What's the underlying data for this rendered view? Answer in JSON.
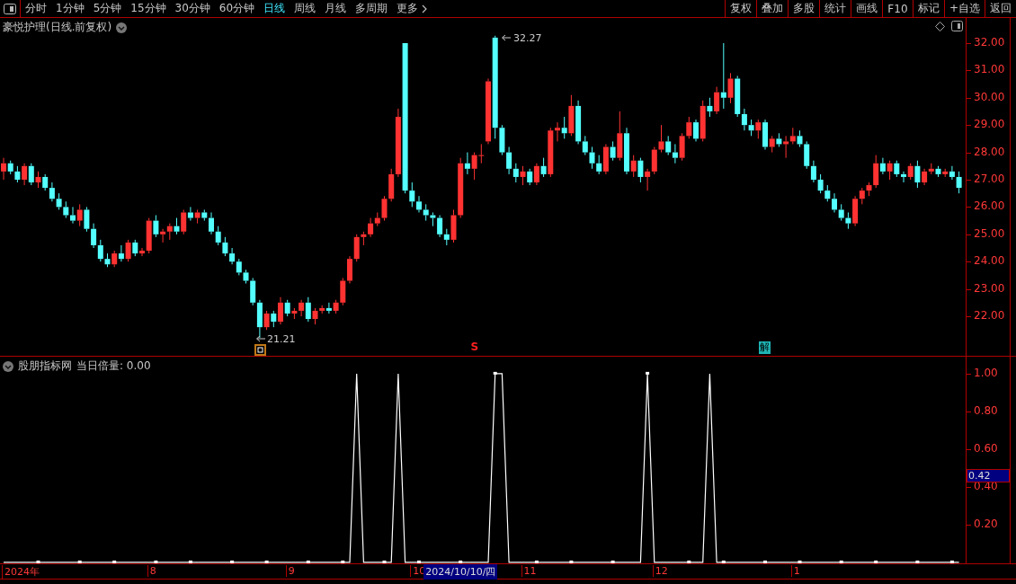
{
  "toolbar": {
    "periods": [
      {
        "label": "分时",
        "selected": false
      },
      {
        "label": "1分钟",
        "selected": false
      },
      {
        "label": "5分钟",
        "selected": false
      },
      {
        "label": "15分钟",
        "selected": false
      },
      {
        "label": "30分钟",
        "selected": false
      },
      {
        "label": "60分钟",
        "selected": false
      },
      {
        "label": "日线",
        "selected": true
      },
      {
        "label": "周线",
        "selected": false
      },
      {
        "label": "月线",
        "selected": false
      },
      {
        "label": "多周期",
        "selected": false
      }
    ],
    "more": "更多",
    "actions": [
      "复权",
      "叠加",
      "多股",
      "统计",
      "画线",
      "F10",
      "标记",
      "+自选",
      "返回"
    ]
  },
  "price_pane": {
    "title": "豪悦护理(日线.前复权)",
    "high_label": "32.27",
    "low_label": "21.21",
    "signals": [
      {
        "kind": "icon"
      },
      {
        "kind": "text",
        "text": "S"
      },
      {
        "kind": "badge",
        "text": "解"
      }
    ],
    "chart_data": {
      "type": "candlestick",
      "ylim": [
        20.52,
        32.92
      ],
      "categories": [
        null,
        null,
        null,
        null,
        null,
        null,
        null,
        null,
        null,
        null,
        null,
        null,
        null,
        null,
        null,
        null,
        null,
        null,
        null,
        null,
        null,
        null,
        null,
        null,
        null,
        null,
        null,
        null,
        null,
        null,
        null,
        null,
        null,
        null,
        null,
        null,
        null,
        null,
        null,
        null,
        null,
        null,
        null,
        null,
        null,
        null,
        null,
        null,
        null,
        null,
        null,
        null,
        null,
        null,
        null,
        null,
        null,
        null,
        null,
        null,
        null,
        null,
        null,
        null,
        null,
        null,
        null,
        null,
        null,
        null,
        null,
        null,
        null,
        null,
        null,
        null,
        null,
        null,
        null,
        null,
        null,
        null,
        null,
        null,
        null,
        null,
        null,
        null,
        null,
        null,
        null,
        null,
        null,
        null,
        null,
        null,
        null,
        null,
        null,
        null,
        null,
        null,
        null,
        null,
        null,
        null,
        null,
        null,
        null,
        null,
        null,
        null,
        null,
        null,
        null,
        null,
        null,
        null,
        null,
        null,
        null,
        null,
        null,
        null,
        null,
        null,
        null,
        null,
        null,
        null,
        null,
        null,
        null,
        null,
        null,
        null,
        null,
        null,
        null
      ],
      "yticks": [
        {
          "value": 32,
          "label": "32.00"
        },
        {
          "value": 31,
          "label": "31.00"
        },
        {
          "value": 30,
          "label": "30.00"
        },
        {
          "value": 29,
          "label": "29.00"
        },
        {
          "value": 28,
          "label": "28.00"
        },
        {
          "value": 27,
          "label": "27.00"
        },
        {
          "value": 26,
          "label": "26.00"
        },
        {
          "value": 25,
          "label": "25.00"
        },
        {
          "value": 24,
          "label": "24.00"
        },
        {
          "value": 23,
          "label": "23.00"
        },
        {
          "value": 22,
          "label": "22.00"
        }
      ],
      "ohlc": [
        [
          27.3,
          27.8,
          27.0,
          27.6
        ],
        [
          27.6,
          27.7,
          27.2,
          27.3
        ],
        [
          27.3,
          27.5,
          26.9,
          27.0
        ],
        [
          27.0,
          27.6,
          26.8,
          27.5
        ],
        [
          27.5,
          27.6,
          26.8,
          26.9
        ],
        [
          26.9,
          27.3,
          26.7,
          27.1
        ],
        [
          27.1,
          27.2,
          26.6,
          26.7
        ],
        [
          26.7,
          26.9,
          26.2,
          26.3
        ],
        [
          26.3,
          26.5,
          25.9,
          26.0
        ],
        [
          26.0,
          26.2,
          25.6,
          25.7
        ],
        [
          25.7,
          26.0,
          25.4,
          25.5
        ],
        [
          25.5,
          26.1,
          25.3,
          25.9
        ],
        [
          25.9,
          26.0,
          25.1,
          25.2
        ],
        [
          25.2,
          25.4,
          24.5,
          24.6
        ],
        [
          24.6,
          24.8,
          24.0,
          24.1
        ],
        [
          24.1,
          24.3,
          23.8,
          23.9
        ],
        [
          23.9,
          24.4,
          23.8,
          24.3
        ],
        [
          24.3,
          24.6,
          24.0,
          24.1
        ],
        [
          24.1,
          24.8,
          24.0,
          24.7
        ],
        [
          24.7,
          24.8,
          24.2,
          24.3
        ],
        [
          24.3,
          24.5,
          24.2,
          24.4
        ],
        [
          24.4,
          25.6,
          24.3,
          25.5
        ],
        [
          25.5,
          25.7,
          24.9,
          25.0
        ],
        [
          25.0,
          25.2,
          24.7,
          25.1
        ],
        [
          25.1,
          25.4,
          24.8,
          25.3
        ],
        [
          25.3,
          25.6,
          25.0,
          25.1
        ],
        [
          25.1,
          25.9,
          25.0,
          25.8
        ],
        [
          25.8,
          26.0,
          25.5,
          25.6
        ],
        [
          25.6,
          25.9,
          25.4,
          25.8
        ],
        [
          25.8,
          25.9,
          25.5,
          25.6
        ],
        [
          25.6,
          25.8,
          25.0,
          25.1
        ],
        [
          25.1,
          25.3,
          24.6,
          24.7
        ],
        [
          24.7,
          24.9,
          24.2,
          24.3
        ],
        [
          24.3,
          24.5,
          23.9,
          24.0
        ],
        [
          24.0,
          24.1,
          23.5,
          23.6
        ],
        [
          23.6,
          23.7,
          23.2,
          23.3
        ],
        [
          23.3,
          23.4,
          22.4,
          22.5
        ],
        [
          22.5,
          22.6,
          21.21,
          21.6
        ],
        [
          21.6,
          22.2,
          21.5,
          22.1
        ],
        [
          22.1,
          22.2,
          21.6,
          21.8
        ],
        [
          21.8,
          22.7,
          21.7,
          22.5
        ],
        [
          22.5,
          22.6,
          22.0,
          22.1
        ],
        [
          22.1,
          22.3,
          21.9,
          22.2
        ],
        [
          22.2,
          22.6,
          22.0,
          22.5
        ],
        [
          22.5,
          22.7,
          21.8,
          21.9
        ],
        [
          21.9,
          22.3,
          21.7,
          22.2
        ],
        [
          22.2,
          22.4,
          22.1,
          22.3
        ],
        [
          22.3,
          22.5,
          22.1,
          22.2
        ],
        [
          22.2,
          22.6,
          22.1,
          22.5
        ],
        [
          22.5,
          23.4,
          22.4,
          23.3
        ],
        [
          23.3,
          24.2,
          23.2,
          24.1
        ],
        [
          24.1,
          25.0,
          24.0,
          24.9
        ],
        [
          24.9,
          25.1,
          24.6,
          25.0
        ],
        [
          25.0,
          25.6,
          24.9,
          25.4
        ],
        [
          25.4,
          25.8,
          25.3,
          25.6
        ],
        [
          25.6,
          26.4,
          25.5,
          26.3
        ],
        [
          26.3,
          27.4,
          26.2,
          27.2
        ],
        [
          27.2,
          29.6,
          27.1,
          29.3
        ],
        [
          32.0,
          32.0,
          26.5,
          26.6
        ],
        [
          26.6,
          26.9,
          26.0,
          26.2
        ],
        [
          26.2,
          26.4,
          25.8,
          25.9
        ],
        [
          25.9,
          26.1,
          25.5,
          25.7
        ],
        [
          25.7,
          25.8,
          25.3,
          25.6
        ],
        [
          25.6,
          25.7,
          24.9,
          25.0
        ],
        [
          25.0,
          25.2,
          24.6,
          24.8
        ],
        [
          24.8,
          25.9,
          24.7,
          25.7
        ],
        [
          25.7,
          27.8,
          25.6,
          27.6
        ],
        [
          27.6,
          28.0,
          27.2,
          27.4
        ],
        [
          27.4,
          28.0,
          27.0,
          27.9
        ],
        [
          27.9,
          28.3,
          27.6,
          27.9
        ],
        [
          28.4,
          30.7,
          28.3,
          30.6
        ],
        [
          32.2,
          32.27,
          28.5,
          28.9
        ],
        [
          28.9,
          29.0,
          27.9,
          28.0
        ],
        [
          28.0,
          28.2,
          27.2,
          27.4
        ],
        [
          27.4,
          27.6,
          26.9,
          27.1
        ],
        [
          27.1,
          27.5,
          26.8,
          27.3
        ],
        [
          27.3,
          27.4,
          26.8,
          26.9
        ],
        [
          26.9,
          27.6,
          26.8,
          27.5
        ],
        [
          27.5,
          27.8,
          27.1,
          27.2
        ],
        [
          27.2,
          28.9,
          27.1,
          28.8
        ],
        [
          28.8,
          29.1,
          28.4,
          28.9
        ],
        [
          28.9,
          29.3,
          28.5,
          28.7
        ],
        [
          28.7,
          30.1,
          28.6,
          29.7
        ],
        [
          29.7,
          29.9,
          28.3,
          28.4
        ],
        [
          28.4,
          28.6,
          27.9,
          28.0
        ],
        [
          28.0,
          28.2,
          27.4,
          27.6
        ],
        [
          27.6,
          27.9,
          27.2,
          27.3
        ],
        [
          27.3,
          28.3,
          27.2,
          28.2
        ],
        [
          28.2,
          28.4,
          27.7,
          27.8
        ],
        [
          27.8,
          29.5,
          27.7,
          28.7
        ],
        [
          28.7,
          28.9,
          27.2,
          27.3
        ],
        [
          27.3,
          27.9,
          27.1,
          27.7
        ],
        [
          27.7,
          27.8,
          26.9,
          27.1
        ],
        [
          27.1,
          27.4,
          26.6,
          27.3
        ],
        [
          27.3,
          28.2,
          27.2,
          28.1
        ],
        [
          28.1,
          29.0,
          28.0,
          28.4
        ],
        [
          28.4,
          28.6,
          27.9,
          28.0
        ],
        [
          28.0,
          28.3,
          27.6,
          27.8
        ],
        [
          27.8,
          28.7,
          27.7,
          28.6
        ],
        [
          28.6,
          29.3,
          28.5,
          29.1
        ],
        [
          29.1,
          29.2,
          28.4,
          28.5
        ],
        [
          28.5,
          29.9,
          28.4,
          29.7
        ],
        [
          29.7,
          30.0,
          29.3,
          29.5
        ],
        [
          29.5,
          30.4,
          29.4,
          30.2
        ],
        [
          30.2,
          32.0,
          29.6,
          30.0
        ],
        [
          30.0,
          30.9,
          29.8,
          30.7
        ],
        [
          30.7,
          30.8,
          29.3,
          29.4
        ],
        [
          29.4,
          29.6,
          28.8,
          29.0
        ],
        [
          29.0,
          29.2,
          28.6,
          28.8
        ],
        [
          28.8,
          29.2,
          28.5,
          29.1
        ],
        [
          29.1,
          29.2,
          28.1,
          28.2
        ],
        [
          28.2,
          28.6,
          28.0,
          28.5
        ],
        [
          28.5,
          28.7,
          28.2,
          28.3
        ],
        [
          28.3,
          28.6,
          27.8,
          28.4
        ],
        [
          28.4,
          28.9,
          28.3,
          28.6
        ],
        [
          28.6,
          28.8,
          28.2,
          28.3
        ],
        [
          28.3,
          28.4,
          27.4,
          27.5
        ],
        [
          27.5,
          27.7,
          26.9,
          27.0
        ],
        [
          27.0,
          27.2,
          26.5,
          26.6
        ],
        [
          26.6,
          26.8,
          26.2,
          26.3
        ],
        [
          26.3,
          26.5,
          25.8,
          25.9
        ],
        [
          25.9,
          26.1,
          25.5,
          25.6
        ],
        [
          25.6,
          25.8,
          25.2,
          25.4
        ],
        [
          25.4,
          26.4,
          25.3,
          26.3
        ],
        [
          26.3,
          26.7,
          26.1,
          26.6
        ],
        [
          26.6,
          26.9,
          26.4,
          26.8
        ],
        [
          26.8,
          27.9,
          26.7,
          27.6
        ],
        [
          27.6,
          27.8,
          27.2,
          27.3
        ],
        [
          27.3,
          27.7,
          27.0,
          27.6
        ],
        [
          27.6,
          27.7,
          27.1,
          27.2
        ],
        [
          27.2,
          27.3,
          26.9,
          27.1
        ],
        [
          27.1,
          27.6,
          27.0,
          27.5
        ],
        [
          27.5,
          27.7,
          26.7,
          26.9
        ],
        [
          26.9,
          27.4,
          26.8,
          27.3
        ],
        [
          27.3,
          27.6,
          27.2,
          27.4
        ],
        [
          27.4,
          27.5,
          27.1,
          27.2
        ],
        [
          27.2,
          27.4,
          27.1,
          27.3
        ],
        [
          27.3,
          27.5,
          27.0,
          27.1
        ],
        [
          27.1,
          27.3,
          26.5,
          26.7
        ]
      ]
    }
  },
  "indicator_pane": {
    "title": "股朋指标网",
    "reading": "当日倍量: 0.00",
    "cursor_value": "0.42",
    "chart_data": {
      "type": "line",
      "ylim": [
        -0.01,
        1.09
      ],
      "categories": [
        null,
        null,
        null,
        null,
        null,
        null,
        null,
        null,
        null,
        null,
        null,
        null,
        null,
        null,
        null,
        null,
        null,
        null,
        null,
        null,
        null,
        null,
        null,
        null,
        null,
        null,
        null,
        null,
        null,
        null,
        null,
        null,
        null,
        null,
        null,
        null,
        null,
        null,
        null,
        null,
        null,
        null,
        null,
        null,
        null,
        null,
        null,
        null,
        null,
        null,
        null,
        null,
        null,
        null,
        null,
        null,
        null,
        null,
        null,
        null,
        null,
        null,
        null,
        null,
        null,
        null,
        null,
        null,
        null,
        null,
        null,
        null,
        null,
        null,
        null,
        null,
        null,
        null,
        null,
        null,
        null,
        null,
        null,
        null,
        null,
        null,
        null,
        null,
        null,
        null,
        null,
        null,
        null,
        null,
        null,
        null,
        null,
        null,
        null,
        null,
        null,
        null,
        null,
        null,
        null,
        null,
        null,
        null,
        null,
        null,
        null,
        null,
        null,
        null,
        null,
        null,
        null,
        null,
        null,
        null,
        null,
        null,
        null,
        null,
        null,
        null,
        null,
        null,
        null,
        null,
        null,
        null,
        null,
        null,
        null,
        null,
        null,
        null,
        null
      ],
      "yticks": [
        {
          "value": 0.2,
          "label": "0.20"
        },
        {
          "value": 0.4,
          "label": "0.40"
        },
        {
          "value": 0.6,
          "label": "0.60"
        },
        {
          "value": 0.8,
          "label": "0.80"
        },
        {
          "value": 1.0,
          "label": "1.00"
        }
      ],
      "series": [
        {
          "color": "#ffffff",
          "values": [
            0,
            0,
            0,
            0,
            0,
            0,
            0,
            0,
            0,
            0,
            0,
            0,
            0,
            0,
            0,
            0,
            0,
            0,
            0,
            0,
            0,
            0,
            0,
            0,
            0,
            0,
            0,
            0,
            0,
            0,
            0,
            0,
            0,
            0,
            0,
            0,
            0,
            0,
            0,
            0,
            0,
            0,
            0,
            0,
            0,
            0,
            0,
            0,
            0,
            0,
            0,
            1,
            0,
            0,
            0,
            0,
            0,
            1,
            0,
            0,
            0,
            0,
            0,
            0,
            0,
            0,
            0,
            0,
            0,
            0,
            0,
            1,
            1,
            0,
            0,
            0,
            0,
            0,
            0,
            0,
            0,
            0,
            0,
            0,
            0,
            0,
            0,
            0,
            0,
            0,
            0,
            0,
            0,
            1,
            0,
            0,
            0,
            0,
            0,
            0,
            0,
            0,
            1,
            0,
            0,
            0,
            0,
            0,
            0,
            0,
            0,
            0,
            0,
            0,
            0,
            0,
            0,
            0,
            0,
            0,
            0,
            0,
            0,
            0,
            0,
            0,
            0,
            0,
            0,
            0,
            0,
            0,
            0,
            0,
            0,
            0,
            0,
            0,
            0
          ]
        }
      ]
    }
  },
  "x_axis": {
    "labels": [
      "2024年",
      "8",
      "9",
      "10",
      "11",
      "12",
      "1"
    ],
    "cursor_date": "2024/10/10/四"
  }
}
